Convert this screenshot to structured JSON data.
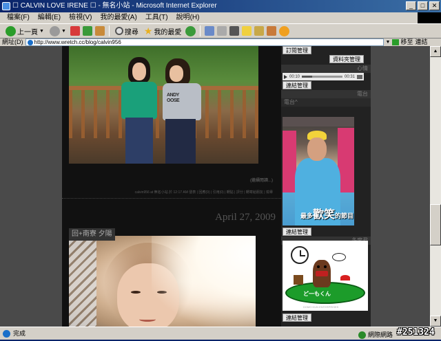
{
  "window": {
    "title": "☐ CALVIN LOVE IRENE ☐ - 無名小站 - Microsoft Internet Explorer",
    "buttons": [
      "_",
      "□",
      "✕"
    ]
  },
  "menu": [
    "檔案(F)",
    "編輯(E)",
    "檢視(V)",
    "我的最愛(A)",
    "工具(T)",
    "說明(H)"
  ],
  "toolbar": {
    "back": "上一頁",
    "search": "搜尋",
    "favorites": "我的最愛"
  },
  "addressbar": {
    "label": "網址(D)",
    "url": "http://www.wretch.cc/blog/calvin956",
    "go": "移至",
    "links": "連結"
  },
  "post1": {
    "shirt_text": "ANDY\nOOSE",
    "meta_line1": "(繼續閱讀...)",
    "meta_line2": "calvin956 at 無名小站 於 12:17 AM 發表 | 回應(0) | 引用(0) | 轉貼 | 評分 | 轉寄給朋友 | 檢舉"
  },
  "post2": {
    "date": "April 27, 2009",
    "title": "回+南寮 夕陽"
  },
  "sidebar": {
    "btn_subscribe": "訂閱管理",
    "btn_folder": "資料夾管理",
    "row_mood": "心情",
    "player_time": "00:10",
    "player_total": "00:31",
    "player_progress": 0.25,
    "btn_link1": "連結管理",
    "row_tv": "電台",
    "row_tv_sub": "電台^",
    "photo_caption_pre": "最多",
    "photo_caption_big": "歡笑",
    "photo_caption_post": "的節目",
    "btn_link2": "連結管理",
    "row_domo": "多摩君",
    "domo_label": "ど一もくん",
    "domo_small": "DOMO KUN ENTERPRISES",
    "btn_link3": "連結管理"
  },
  "status": {
    "text": "完成",
    "zone": "網際網路",
    "id_tag": "#251324"
  }
}
